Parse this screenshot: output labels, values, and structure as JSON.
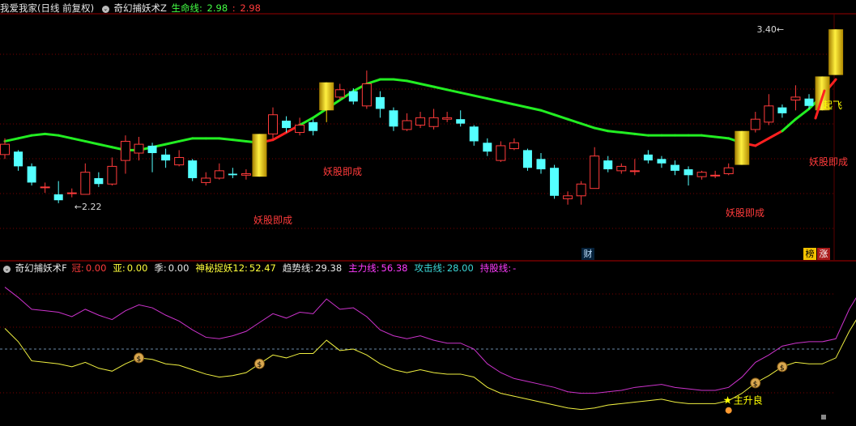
{
  "header": {
    "stock": "我爱我家(日线 前复权)",
    "indicator": "奇幻捕妖术Z",
    "life_label": "生命线:",
    "life_value": "2.98",
    "sep": ":",
    "life_value2": "2.98"
  },
  "sub_header": {
    "indicator": "奇幻捕妖术F",
    "items": [
      {
        "label": "冠:",
        "value": "0.00",
        "color": "#ff3b3b"
      },
      {
        "label": "亚:",
        "value": "0.00",
        "color": "#ffff3b"
      },
      {
        "label": "季:",
        "value": "0.00",
        "color": "#e6e6e6"
      },
      {
        "label": "神秘捉妖12:",
        "value": "52.47",
        "color": "#ffff3b"
      },
      {
        "label": "趋势线:",
        "value": "29.38",
        "color": "#e6e6e6"
      },
      {
        "label": "主力线:",
        "value": "56.38",
        "color": "#ff3bff"
      },
      {
        "label": "攻击线:",
        "value": "28.00",
        "color": "#3bd6d6"
      },
      {
        "label": "持股线:",
        "value": "-",
        "color": "#ff3bff"
      }
    ]
  },
  "badges": {
    "cai": "财",
    "bang": "榜",
    "zhang": "涨"
  },
  "colors": {
    "up": "#ff3b3b",
    "down": "#54ffff",
    "life_up": "#ff2020",
    "life_down": "#22ee22",
    "gold": "#f2d000",
    "main_line": "#cc33cc",
    "trend_line": "#f0f040",
    "grid": "#7a0000"
  },
  "chart_data": [
    {
      "type": "candlestick",
      "title": "奇幻捕妖术Z",
      "ylim": [
        1.95,
        3.5
      ],
      "annotations": [
        {
          "text": "2.22",
          "at_index": 5,
          "value": 2.22
        },
        {
          "text": "3.40",
          "at_index": 59,
          "value": 3.4
        },
        {
          "text": "妖股即成",
          "at_index": 19,
          "color": "#ff3b3b"
        },
        {
          "text": "妖股即成",
          "at_index": 23,
          "color": "#ff3b3b"
        },
        {
          "text": "妖股即成",
          "at_index": 53,
          "color": "#ff3b3b"
        },
        {
          "text": "妖股即成",
          "at_index": 59,
          "color": "#ff3b3b"
        },
        {
          "text": "起飞",
          "at_index": 59,
          "color": "#ffff00"
        }
      ],
      "candles": [
        {
          "o": 2.55,
          "c": 2.62,
          "h": 2.66,
          "l": 2.52
        },
        {
          "o": 2.57,
          "c": 2.47,
          "h": 2.58,
          "l": 2.44
        },
        {
          "o": 2.47,
          "c": 2.36,
          "h": 2.49,
          "l": 2.34
        },
        {
          "o": 2.33,
          "c": 2.33,
          "h": 2.36,
          "l": 2.29
        },
        {
          "o": 2.28,
          "c": 2.24,
          "h": 2.37,
          "l": 2.22
        },
        {
          "o": 2.29,
          "c": 2.29,
          "h": 2.32,
          "l": 2.26
        },
        {
          "o": 2.28,
          "c": 2.43,
          "h": 2.49,
          "l": 2.28
        },
        {
          "o": 2.39,
          "c": 2.35,
          "h": 2.43,
          "l": 2.33
        },
        {
          "o": 2.35,
          "c": 2.47,
          "h": 2.53,
          "l": 2.34
        },
        {
          "o": 2.51,
          "c": 2.64,
          "h": 2.68,
          "l": 2.42
        },
        {
          "o": 2.56,
          "c": 2.62,
          "h": 2.67,
          "l": 2.51
        },
        {
          "o": 2.61,
          "c": 2.56,
          "h": 2.63,
          "l": 2.43
        },
        {
          "o": 2.55,
          "c": 2.51,
          "h": 2.59,
          "l": 2.46
        },
        {
          "o": 2.48,
          "c": 2.53,
          "h": 2.58,
          "l": 2.47
        },
        {
          "o": 2.51,
          "c": 2.39,
          "h": 2.52,
          "l": 2.37
        },
        {
          "o": 2.36,
          "c": 2.39,
          "h": 2.43,
          "l": 2.34
        },
        {
          "o": 2.39,
          "c": 2.44,
          "h": 2.49,
          "l": 2.38
        },
        {
          "o": 2.42,
          "c": 2.41,
          "h": 2.46,
          "l": 2.39
        },
        {
          "o": 2.41,
          "c": 2.42,
          "h": 2.45,
          "l": 2.38
        },
        {
          "o": 2.4,
          "c": 2.69,
          "h": 2.69,
          "l": 2.4,
          "gold": true
        },
        {
          "o": 2.69,
          "c": 2.82,
          "h": 2.87,
          "l": 2.66
        },
        {
          "o": 2.78,
          "c": 2.73,
          "h": 2.81,
          "l": 2.7
        },
        {
          "o": 2.7,
          "c": 2.75,
          "h": 2.8,
          "l": 2.68
        },
        {
          "o": 2.77,
          "c": 2.71,
          "h": 2.79,
          "l": 2.68
        },
        {
          "o": 2.85,
          "c": 3.04,
          "h": 3.04,
          "l": 2.77,
          "gold": true
        },
        {
          "o": 2.94,
          "c": 2.99,
          "h": 3.03,
          "l": 2.92
        },
        {
          "o": 2.98,
          "c": 2.91,
          "h": 3.0,
          "l": 2.89
        },
        {
          "o": 2.88,
          "c": 3.03,
          "h": 3.12,
          "l": 2.86
        },
        {
          "o": 2.94,
          "c": 2.86,
          "h": 2.98,
          "l": 2.8
        },
        {
          "o": 2.85,
          "c": 2.74,
          "h": 2.87,
          "l": 2.71
        },
        {
          "o": 2.72,
          "c": 2.78,
          "h": 2.83,
          "l": 2.71
        },
        {
          "o": 2.75,
          "c": 2.8,
          "h": 2.84,
          "l": 2.73
        },
        {
          "o": 2.74,
          "c": 2.8,
          "h": 2.86,
          "l": 2.72
        },
        {
          "o": 2.79,
          "c": 2.8,
          "h": 2.84,
          "l": 2.77
        },
        {
          "o": 2.79,
          "c": 2.76,
          "h": 2.85,
          "l": 2.74
        },
        {
          "o": 2.74,
          "c": 2.64,
          "h": 2.75,
          "l": 2.61
        },
        {
          "o": 2.63,
          "c": 2.57,
          "h": 2.66,
          "l": 2.54
        },
        {
          "o": 2.51,
          "c": 2.61,
          "h": 2.64,
          "l": 2.5
        },
        {
          "o": 2.59,
          "c": 2.63,
          "h": 2.66,
          "l": 2.58
        },
        {
          "o": 2.58,
          "c": 2.46,
          "h": 2.59,
          "l": 2.44
        },
        {
          "o": 2.52,
          "c": 2.45,
          "h": 2.56,
          "l": 2.42
        },
        {
          "o": 2.46,
          "c": 2.27,
          "h": 2.48,
          "l": 2.25
        },
        {
          "o": 2.25,
          "c": 2.27,
          "h": 2.3,
          "l": 2.21
        },
        {
          "o": 2.27,
          "c": 2.35,
          "h": 2.37,
          "l": 2.21
        },
        {
          "o": 2.32,
          "c": 2.54,
          "h": 2.6,
          "l": 2.32
        },
        {
          "o": 2.51,
          "c": 2.45,
          "h": 2.54,
          "l": 2.43
        },
        {
          "o": 2.44,
          "c": 2.47,
          "h": 2.49,
          "l": 2.42
        },
        {
          "o": 2.44,
          "c": 2.44,
          "h": 2.52,
          "l": 2.41
        },
        {
          "o": 2.55,
          "c": 2.51,
          "h": 2.58,
          "l": 2.49
        },
        {
          "o": 2.52,
          "c": 2.49,
          "h": 2.54,
          "l": 2.46
        },
        {
          "o": 2.48,
          "c": 2.44,
          "h": 2.51,
          "l": 2.41
        },
        {
          "o": 2.45,
          "c": 2.41,
          "h": 2.47,
          "l": 2.34
        },
        {
          "o": 2.4,
          "c": 2.43,
          "h": 2.44,
          "l": 2.38
        },
        {
          "o": 2.41,
          "c": 2.41,
          "h": 2.44,
          "l": 2.39
        },
        {
          "o": 2.42,
          "c": 2.46,
          "h": 2.49,
          "l": 2.41
        },
        {
          "o": 2.48,
          "c": 2.71,
          "h": 2.71,
          "l": 2.48,
          "gold": true
        },
        {
          "o": 2.72,
          "c": 2.79,
          "h": 2.84,
          "l": 2.7
        },
        {
          "o": 2.77,
          "c": 2.88,
          "h": 2.96,
          "l": 2.75
        },
        {
          "o": 2.87,
          "c": 2.83,
          "h": 2.89,
          "l": 2.8
        },
        {
          "o": 2.92,
          "c": 2.94,
          "h": 3.02,
          "l": 2.85
        },
        {
          "o": 2.93,
          "c": 2.88,
          "h": 2.96,
          "l": 2.86
        },
        {
          "o": 2.85,
          "c": 3.08,
          "h": 3.08,
          "l": 2.85,
          "gold": true
        },
        {
          "o": 3.09,
          "c": 3.4,
          "h": 3.4,
          "l": 3.09,
          "gold": true
        }
      ],
      "life_line": [
        2.64,
        2.66,
        2.68,
        2.69,
        2.68,
        2.66,
        2.64,
        2.62,
        2.6,
        2.58,
        2.58,
        2.6,
        2.62,
        2.64,
        2.66,
        2.66,
        2.66,
        2.65,
        2.64,
        2.63,
        2.65,
        2.7,
        2.75,
        2.8,
        2.86,
        2.92,
        2.98,
        3.03,
        3.06,
        3.06,
        3.05,
        3.03,
        3.01,
        2.99,
        2.97,
        2.95,
        2.93,
        2.91,
        2.89,
        2.87,
        2.85,
        2.82,
        2.79,
        2.76,
        2.73,
        2.71,
        2.7,
        2.69,
        2.68,
        2.68,
        2.68,
        2.68,
        2.68,
        2.67,
        2.66,
        2.63,
        2.61,
        2.66,
        2.71,
        2.79,
        2.86,
        2.95,
        3.06
      ],
      "life_up": [
        0,
        0,
        0,
        0,
        0,
        0,
        0,
        0,
        0,
        0,
        0,
        0,
        0,
        0,
        0,
        0,
        0,
        0,
        0,
        1,
        1,
        1,
        1,
        0,
        0,
        0,
        0,
        0,
        0,
        0,
        0,
        0,
        0,
        0,
        0,
        0,
        0,
        0,
        0,
        0,
        0,
        0,
        0,
        0,
        0,
        0,
        0,
        0,
        0,
        0,
        0,
        0,
        0,
        0,
        0,
        1,
        1,
        1,
        1,
        0,
        0,
        1,
        1
      ]
    },
    {
      "type": "line",
      "title": "奇幻捕妖术F",
      "ylim": [
        0,
        100
      ],
      "reference_line": 50,
      "series": [
        {
          "name": "主力线",
          "values": [
            92,
            85,
            77,
            76,
            75,
            72,
            77,
            73,
            70,
            76,
            80,
            78,
            73,
            69,
            63,
            58,
            57,
            59,
            62,
            68,
            74,
            71,
            75,
            74,
            84,
            77,
            78,
            72,
            63,
            59,
            57,
            59,
            56,
            54,
            54,
            50,
            40,
            34,
            30,
            28,
            26,
            24,
            21,
            20,
            20,
            21,
            22,
            24,
            25,
            26,
            24,
            23,
            22,
            22,
            24,
            31,
            41,
            46,
            52,
            54,
            55,
            55,
            57,
            77,
            92
          ]
        },
        {
          "name": "趋势线",
          "values": [
            64,
            55,
            42,
            41,
            40,
            38,
            41,
            37,
            35,
            40,
            44,
            43,
            40,
            39,
            36,
            33,
            31,
            32,
            34,
            40,
            46,
            44,
            47,
            47,
            56,
            49,
            50,
            46,
            40,
            36,
            34,
            36,
            34,
            33,
            33,
            31,
            24,
            20,
            18,
            16,
            14,
            12,
            10,
            9,
            10,
            12,
            13,
            14,
            15,
            16,
            14,
            13,
            13,
            13,
            15,
            20,
            27,
            32,
            38,
            41,
            40,
            40,
            44,
            62,
            77
          ]
        }
      ],
      "markers": [
        {
          "type": "moneybag",
          "at_index": 10
        },
        {
          "type": "moneybag",
          "at_index": 19
        },
        {
          "type": "moneybag",
          "at_index": 56
        },
        {
          "type": "moneybag",
          "at_index": 58
        },
        {
          "type": "star",
          "at_index": 54,
          "text": "主升良"
        }
      ]
    }
  ]
}
